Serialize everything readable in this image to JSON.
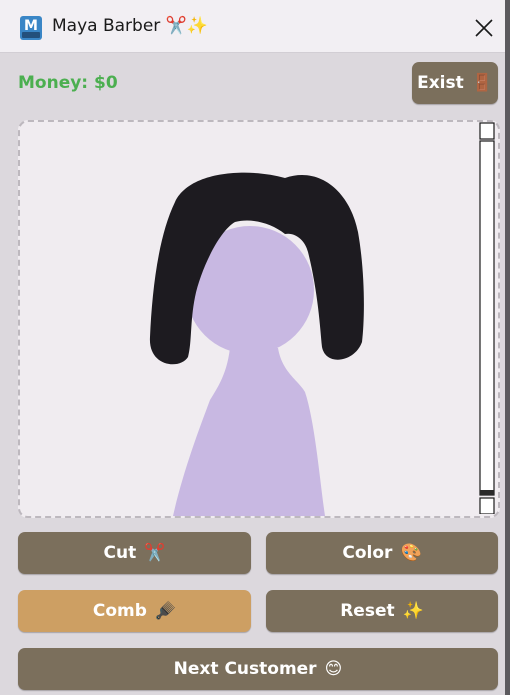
{
  "window": {
    "title": "Maya Barber",
    "title_emojis": "✂️✨"
  },
  "header": {
    "money_label": "Money: $0",
    "exit_label": "Exist",
    "exit_emoji": "🚪"
  },
  "canvas": {
    "scroll_fraction": 0.97,
    "colors": {
      "background": "#f0ecf0",
      "hair": "#1d1b20",
      "skin": "#c8b8e2"
    }
  },
  "tools": {
    "cut": {
      "label": "Cut",
      "emoji": "✂️"
    },
    "color": {
      "label": "Color",
      "emoji": "🎨"
    },
    "comb": {
      "label": "Comb",
      "emoji": "🪮",
      "active": true
    },
    "reset": {
      "label": "Reset",
      "emoji": "✨"
    },
    "next": {
      "label": "Next Customer",
      "emoji": "😊"
    }
  },
  "theme": {
    "button": "#7b6f5c",
    "button_active": "#cd9f63",
    "money": "#4caf50",
    "panel": "#dcd8dd"
  }
}
